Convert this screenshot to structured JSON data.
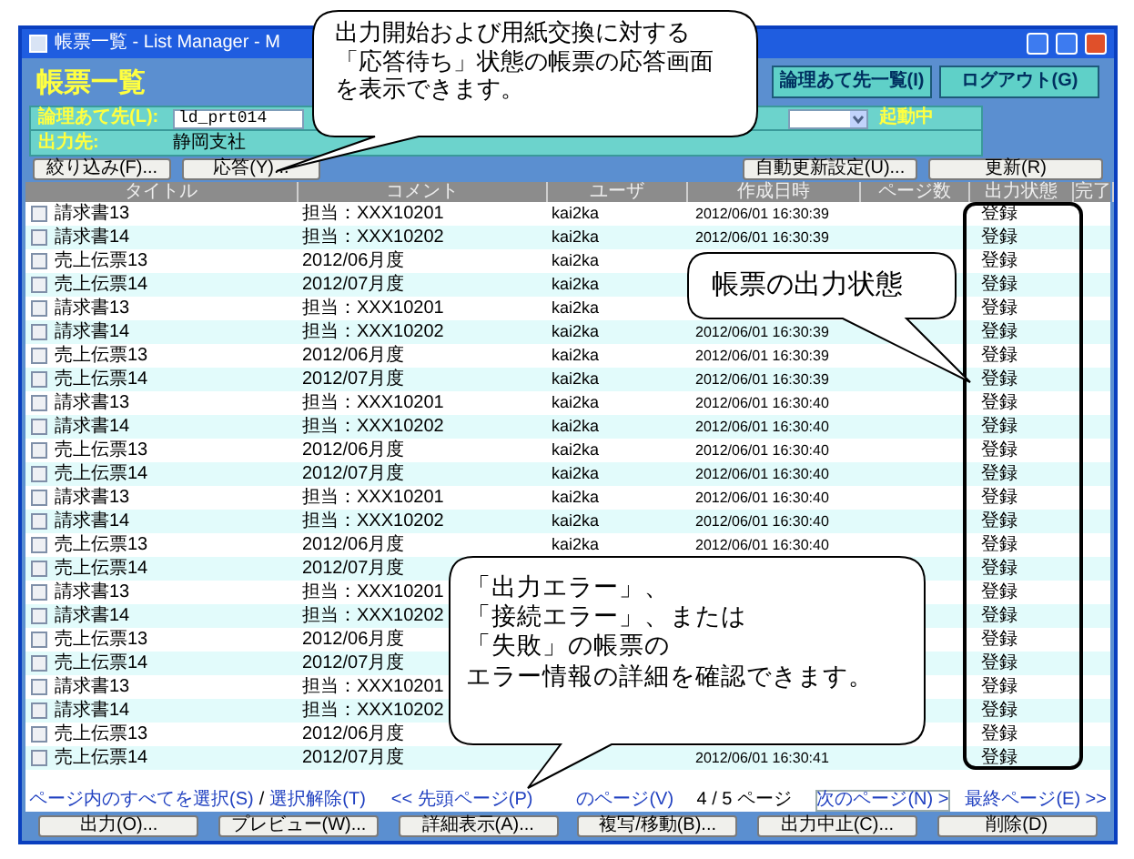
{
  "window": {
    "title": "帳票一覧 - List Manager - M"
  },
  "header": {
    "title": "帳票一覧",
    "buttons": [
      "論理あて先一覧(I)",
      "ログアウト(G)"
    ]
  },
  "info": {
    "destination_label": "論理あて先(L):",
    "destination_value": "ld_prt014",
    "status": "起動中",
    "output_label": "出力先:",
    "output_value": "静岡支社"
  },
  "toolbar": {
    "left": [
      "絞り込み(F)...",
      "応答(Y)..."
    ],
    "right": [
      "自動更新設定(U)...",
      "更新(R)"
    ]
  },
  "table": {
    "columns": [
      "タイトル",
      "コメント",
      "ユーザ",
      "作成日時",
      "ページ数",
      "出力状態",
      "完了"
    ],
    "rows": [
      {
        "checked": false,
        "title": "請求書13",
        "comment": "担当：XXX10201",
        "user": "kai2ka",
        "created": "2012/06/01 16:30:39",
        "status": "登録"
      },
      {
        "checked": false,
        "title": "請求書14",
        "comment": "担当：XXX10202",
        "user": "kai2ka",
        "created": "2012/06/01 16:30:39",
        "status": "登録"
      },
      {
        "checked": false,
        "title": "売上伝票13",
        "comment": "2012/06月度",
        "user": "kai2ka",
        "status": "登録"
      },
      {
        "checked": false,
        "title": "売上伝票14",
        "comment": "2012/07月度",
        "user": "kai2ka",
        "status": "登録"
      },
      {
        "checked": false,
        "title": "請求書13",
        "comment": "担当：XXX10201",
        "user": "kai2ka",
        "status": "登録"
      },
      {
        "checked": false,
        "title": "請求書14",
        "comment": "担当：XXX10202",
        "user": "kai2ka",
        "created": "2012/06/01 16:30:39",
        "status": "登録"
      },
      {
        "checked": false,
        "title": "売上伝票13",
        "comment": "2012/06月度",
        "user": "kai2ka",
        "created": "2012/06/01 16:30:39",
        "status": "登録"
      },
      {
        "checked": false,
        "title": "売上伝票14",
        "comment": "2012/07月度",
        "user": "kai2ka",
        "created": "2012/06/01 16:30:39",
        "status": "登録"
      },
      {
        "checked": false,
        "title": "請求書13",
        "comment": "担当：XXX10201",
        "user": "kai2ka",
        "created": "2012/06/01 16:30:40",
        "status": "登録"
      },
      {
        "checked": false,
        "title": "請求書14",
        "comment": "担当：XXX10202",
        "user": "kai2ka",
        "created": "2012/06/01 16:30:40",
        "status": "登録"
      },
      {
        "checked": false,
        "title": "売上伝票13",
        "comment": "2012/06月度",
        "user": "kai2ka",
        "created": "2012/06/01 16:30:40",
        "status": "登録"
      },
      {
        "checked": false,
        "title": "売上伝票14",
        "comment": "2012/07月度",
        "user": "kai2ka",
        "created": "2012/06/01 16:30:40",
        "status": "登録"
      },
      {
        "checked": false,
        "title": "請求書13",
        "comment": "担当：XXX10201",
        "user": "kai2ka",
        "created": "2012/06/01 16:30:40",
        "status": "登録"
      },
      {
        "checked": false,
        "title": "請求書14",
        "comment": "担当：XXX10202",
        "user": "kai2ka",
        "created": "2012/06/01 16:30:40",
        "status": "登録"
      },
      {
        "checked": false,
        "title": "売上伝票13",
        "comment": "2012/06月度",
        "user": "kai2ka",
        "created": "2012/06/01 16:30:40",
        "status": "登録"
      },
      {
        "checked": false,
        "title": "売上伝票14",
        "comment": "2012/07月度",
        "status": "登録"
      },
      {
        "checked": false,
        "title": "請求書13",
        "comment": "担当：XXX10201",
        "status": "登録"
      },
      {
        "checked": false,
        "title": "請求書14",
        "comment": "担当：XXX10202",
        "status": "登録"
      },
      {
        "checked": false,
        "title": "売上伝票13",
        "comment": "2012/06月度",
        "status": "登録"
      },
      {
        "checked": false,
        "title": "売上伝票14",
        "comment": "2012/07月度",
        "status": "登録"
      },
      {
        "checked": false,
        "title": "請求書13",
        "comment": "担当：XXX10201",
        "status": "登録"
      },
      {
        "checked": false,
        "title": "請求書14",
        "comment": "担当：XXX10202",
        "status": "登録"
      },
      {
        "checked": false,
        "title": "売上伝票13",
        "comment": "2012/06月度",
        "status": "登録"
      },
      {
        "checked": false,
        "title": "売上伝票14",
        "comment": "2012/07月度",
        "created": "2012/06/01 16:30:41",
        "status": "登録"
      }
    ]
  },
  "pager": {
    "select_all": "ページ内のすべてを選択(S)",
    "separator": "/",
    "deselect": "選択解除(T)",
    "first": "<< 先頭ページ(P)",
    "previous": "のページ(V)",
    "page": "4 / 5 ページ",
    "next": "次のページ(N) >",
    "last": "最終ページ(E) >>"
  },
  "buttons": [
    "出力(O)...",
    "プレビュー(W)...",
    "詳細表示(A)...",
    "複写/移動(B)...",
    "出力中止(C)...",
    "削除(D)"
  ],
  "callouts": [
    {
      "lines": [
        "出力開始および用紙交換に対する",
        "「応答待ち」状態の帳票の応答画面",
        "を表示できます。"
      ]
    },
    {
      "lines": [
        "帳票の出力状態"
      ]
    },
    {
      "lines": [
        "「出力エラー」、",
        "「接続エラー」、または",
        "「失敗」の帳票の",
        "エラー情報の詳細を確認できます。"
      ]
    }
  ]
}
